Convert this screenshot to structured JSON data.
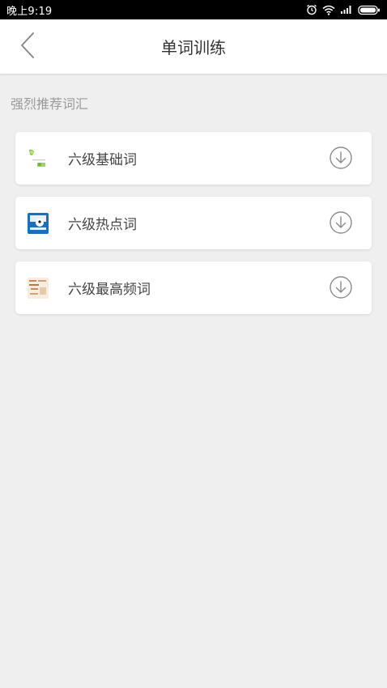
{
  "status_bar": {
    "time": "晚上9:19",
    "icons": [
      "alarm-icon",
      "wifi-icon",
      "signal-icon",
      "battery-icon"
    ]
  },
  "header": {
    "back_icon": "chevron-left-icon",
    "title": "单词训练"
  },
  "section": {
    "label": "强烈推荐词汇"
  },
  "items": [
    {
      "label": "六级基础词",
      "thumb": "thumbnail-basic",
      "action_icon": "download-icon"
    },
    {
      "label": "六级热点词",
      "thumb": "thumbnail-hot",
      "action_icon": "download-icon"
    },
    {
      "label": "六级最高频词",
      "thumb": "thumbnail-frequent",
      "action_icon": "download-icon"
    }
  ],
  "colors": {
    "background": "#efefef",
    "card": "#ffffff",
    "title_text": "#333333",
    "section_text": "#9a9a9a",
    "icon_gray": "#8a8a8a"
  }
}
